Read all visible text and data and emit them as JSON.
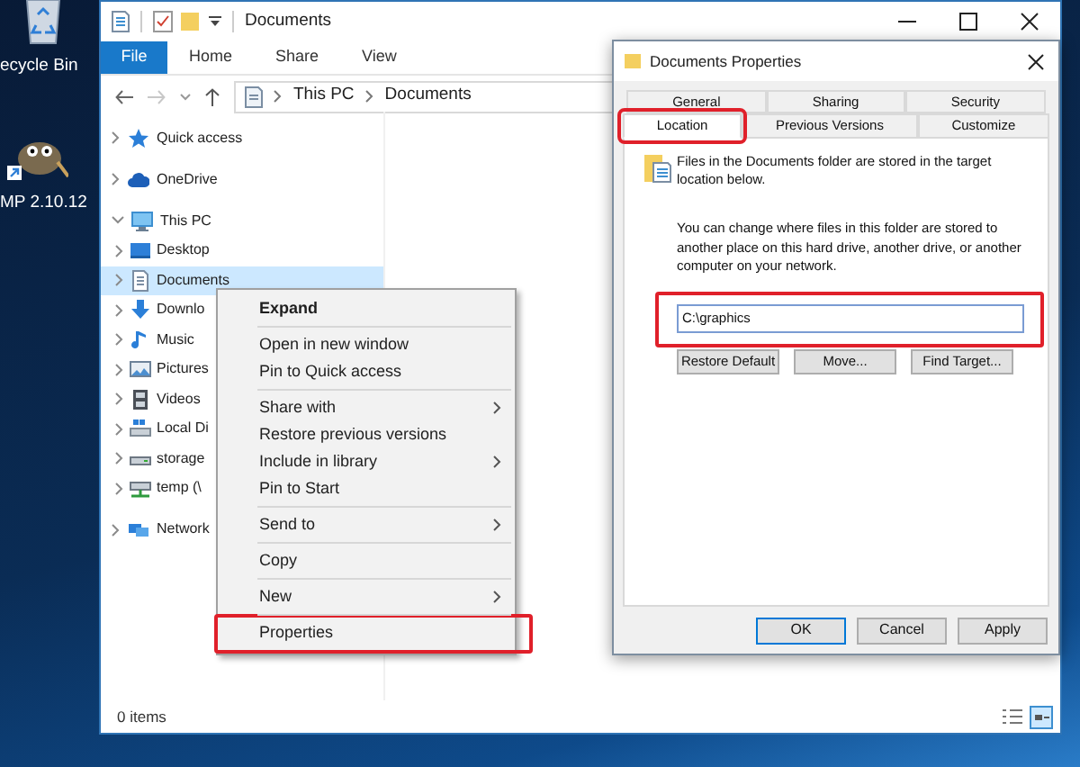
{
  "desktop_icons": [
    {
      "label": "ecycle Bin",
      "kind": "bin"
    },
    {
      "label": "MP 2.10.12",
      "kind": "app"
    }
  ],
  "explorer": {
    "title": "Documents",
    "file_tab": "File",
    "ribbon_tabs": [
      "Home",
      "Share",
      "View"
    ],
    "breadcrumb": [
      "This PC",
      "Documents"
    ],
    "nav_items": [
      {
        "label": "Quick access",
        "kind": "star",
        "expanded": false,
        "selected": false
      },
      {
        "label": "OneDrive",
        "kind": "cloud",
        "expanded": false,
        "selected": false
      },
      {
        "label": "This PC",
        "kind": "computer",
        "expanded": true,
        "selected": false,
        "children": [
          {
            "label": "Desktop",
            "kind": "desktop",
            "expanded": false,
            "selected": false
          },
          {
            "label": "Documents",
            "kind": "document",
            "expanded": false,
            "selected": true
          },
          {
            "label": "Downlo",
            "kind": "download",
            "expanded": false,
            "selected": false
          },
          {
            "label": "Music",
            "kind": "music",
            "expanded": false,
            "selected": false
          },
          {
            "label": "Pictures",
            "kind": "picture",
            "expanded": false,
            "selected": false
          },
          {
            "label": "Videos",
            "kind": "video",
            "expanded": false,
            "selected": false
          },
          {
            "label": "Local Di",
            "kind": "disk",
            "expanded": false,
            "selected": false
          },
          {
            "label": "storage",
            "kind": "drive",
            "expanded": false,
            "selected": false
          },
          {
            "label": "temp (\\",
            "kind": "share",
            "expanded": false,
            "selected": false
          }
        ]
      },
      {
        "label": "Network",
        "kind": "network",
        "expanded": false,
        "selected": false
      }
    ],
    "status": "0 items"
  },
  "context_menu": {
    "groups": [
      [
        {
          "label": "Expand",
          "kind": "default",
          "submenu": false,
          "annotated": false
        }
      ],
      [
        {
          "label": "Open in new window",
          "kind": "item",
          "submenu": false,
          "annotated": false
        },
        {
          "label": "Pin to Quick access",
          "kind": "item",
          "submenu": false,
          "annotated": false
        }
      ],
      [
        {
          "label": "Share with",
          "kind": "item",
          "submenu": true,
          "annotated": false
        },
        {
          "label": "Restore previous versions",
          "kind": "item",
          "submenu": false,
          "annotated": false
        },
        {
          "label": "Include in library",
          "kind": "item",
          "submenu": true,
          "annotated": false
        },
        {
          "label": "Pin to Start",
          "kind": "item",
          "submenu": false,
          "annotated": false
        }
      ],
      [
        {
          "label": "Send to",
          "kind": "item",
          "submenu": true,
          "annotated": false
        }
      ],
      [
        {
          "label": "Copy",
          "kind": "item",
          "submenu": false,
          "annotated": false
        }
      ],
      [
        {
          "label": "New",
          "kind": "item",
          "submenu": true,
          "annotated": false
        }
      ],
      [
        {
          "label": "Properties",
          "kind": "item",
          "submenu": false,
          "annotated": true
        }
      ]
    ]
  },
  "dialog": {
    "title": "Documents Properties",
    "tab_rows": [
      [
        {
          "label": "General",
          "selected": false,
          "annotated": false
        },
        {
          "label": "Sharing",
          "selected": false,
          "annotated": false
        },
        {
          "label": "Security",
          "selected": false,
          "annotated": false
        }
      ],
      [
        {
          "label": "Location",
          "selected": true,
          "annotated": true
        },
        {
          "label": "Previous Versions",
          "selected": false,
          "annotated": false
        },
        {
          "label": "Customize",
          "selected": false,
          "annotated": false
        }
      ]
    ],
    "info": "Files in the Documents folder are stored in the target location below.",
    "description": "You can change where files in this folder are stored to another place on this hard drive, another drive, or another computer on your network.",
    "path": {
      "value": "C:\\graphics",
      "annotated": true
    },
    "actions": [
      "Restore Default",
      "Move...",
      "Find Target..."
    ],
    "buttons": [
      {
        "label": "OK",
        "default": true
      },
      {
        "label": "Cancel",
        "default": false
      },
      {
        "label": "Apply",
        "default": false
      }
    ]
  }
}
